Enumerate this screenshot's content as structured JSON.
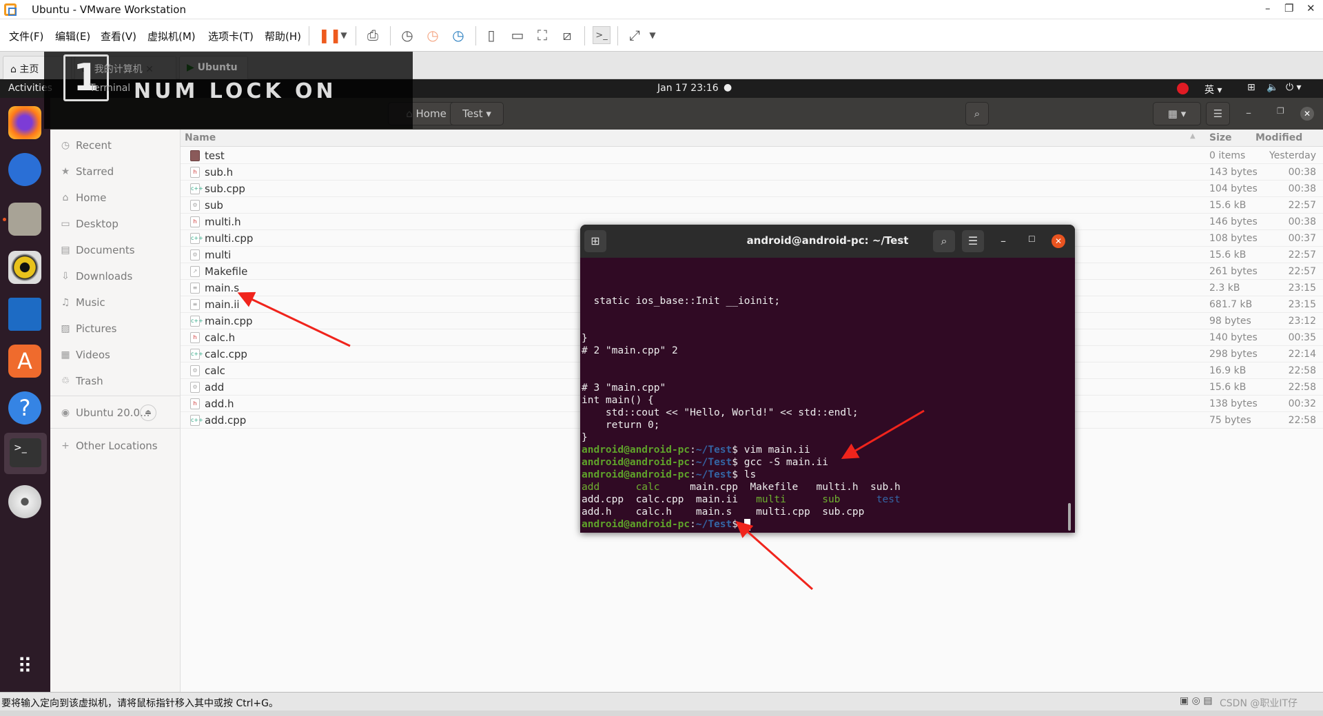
{
  "window": {
    "title": "Ubuntu - VMware Workstation",
    "min": "–",
    "max": "❐",
    "close": "✕"
  },
  "menu": [
    "文件(F)",
    "编辑(E)",
    "查看(V)",
    "虚拟机(M)",
    "选项卡(T)",
    "帮助(H)"
  ],
  "toolbar_icons": [
    "pause-icon",
    "send-keys-icon",
    "snapshot-icon",
    "revert-snapshot-icon",
    "snapshot-manager-icon",
    "sidebar-view-icon",
    "thumbnail-view-icon",
    "fullscreen-icon",
    "unity-icon",
    "console-view-icon",
    "stretch-icon"
  ],
  "tabs": [
    {
      "label": "主页"
    },
    {
      "label": "我的计算机"
    },
    {
      "label": "Ubuntu"
    }
  ],
  "gnome": {
    "activities": "Activities",
    "app": "Terminal",
    "clock": "Jan 17  23:16",
    "ime": "英"
  },
  "numlock": {
    "digit": "1",
    "text": "NUM LOCK ON"
  },
  "nautilus": {
    "path": [
      "Home",
      "Test"
    ],
    "columns": {
      "name": "Name",
      "size": "Size",
      "modified": "Modified"
    }
  },
  "sidebar": [
    {
      "label": "Recent",
      "icon": "◷"
    },
    {
      "label": "Starred",
      "icon": "★"
    },
    {
      "label": "Home",
      "icon": "⌂"
    },
    {
      "label": "Desktop",
      "icon": "▭"
    },
    {
      "label": "Documents",
      "icon": "▤"
    },
    {
      "label": "Downloads",
      "icon": "⇩"
    },
    {
      "label": "Music",
      "icon": "♫"
    },
    {
      "label": "Pictures",
      "icon": "▨"
    },
    {
      "label": "Videos",
      "icon": "▦"
    },
    {
      "label": "Trash",
      "icon": "♲"
    }
  ],
  "volume": {
    "label": "Ubuntu 20.0...",
    "eject": "⏏"
  },
  "other_locations": "Other Locations",
  "files": [
    {
      "name": "test",
      "type": "folder",
      "size": "0 items",
      "modified": "Yesterday"
    },
    {
      "name": "sub.h",
      "type": "h",
      "size": "143 bytes",
      "modified": "00:38"
    },
    {
      "name": "sub.cpp",
      "type": "cpp",
      "size": "104 bytes",
      "modified": "00:38"
    },
    {
      "name": "sub",
      "type": "exec",
      "size": "15.6 kB",
      "modified": "22:57"
    },
    {
      "name": "multi.h",
      "type": "h",
      "size": "146 bytes",
      "modified": "00:38"
    },
    {
      "name": "multi.cpp",
      "type": "cpp",
      "size": "108 bytes",
      "modified": "00:37"
    },
    {
      "name": "multi",
      "type": "exec",
      "size": "15.6 kB",
      "modified": "22:57"
    },
    {
      "name": "Makefile",
      "type": "make",
      "size": "261 bytes",
      "modified": "22:57"
    },
    {
      "name": "main.s",
      "type": "text",
      "size": "2.3 kB",
      "modified": "23:15"
    },
    {
      "name": "main.ii",
      "type": "text",
      "size": "681.7 kB",
      "modified": "23:15"
    },
    {
      "name": "main.cpp",
      "type": "cpp",
      "size": "98 bytes",
      "modified": "23:12"
    },
    {
      "name": "calc.h",
      "type": "h",
      "size": "140 bytes",
      "modified": "00:35"
    },
    {
      "name": "calc.cpp",
      "type": "cpp",
      "size": "298 bytes",
      "modified": "22:14"
    },
    {
      "name": "calc",
      "type": "exec",
      "size": "16.9 kB",
      "modified": "22:58"
    },
    {
      "name": "add",
      "type": "exec",
      "size": "15.6 kB",
      "modified": "22:58"
    },
    {
      "name": "add.h",
      "type": "h",
      "size": "138 bytes",
      "modified": "00:32"
    },
    {
      "name": "add.cpp",
      "type": "cpp",
      "size": "75 bytes",
      "modified": "22:58"
    }
  ],
  "terminal": {
    "title": "android@android-pc: ~/Test",
    "lines": [
      [],
      [],
      [],
      [
        {
          "t": "  static ios_base::Init __ioinit;"
        }
      ],
      [],
      [],
      [
        {
          "t": "}"
        }
      ],
      [
        {
          "t": "# 2 \"main.cpp\" 2"
        }
      ],
      [],
      [],
      [
        {
          "t": "# 3 \"main.cpp\""
        }
      ],
      [
        {
          "t": "int main() {"
        }
      ],
      [
        {
          "t": "    std::cout << \"Hello, World!\" << std::endl;"
        }
      ],
      [
        {
          "t": "    return 0;"
        }
      ],
      [
        {
          "t": "}"
        }
      ],
      [
        {
          "t": "android@android-pc",
          "c": "green"
        },
        {
          "t": ":"
        },
        {
          "t": "~/Test",
          "c": "blue"
        },
        {
          "t": "$ vim main.ii"
        }
      ],
      [
        {
          "t": "android@android-pc",
          "c": "green"
        },
        {
          "t": ":"
        },
        {
          "t": "~/Test",
          "c": "blue"
        },
        {
          "t": "$ gcc -S main.ii"
        }
      ],
      [
        {
          "t": "android@android-pc",
          "c": "green"
        },
        {
          "t": ":"
        },
        {
          "t": "~/Test",
          "c": "blue"
        },
        {
          "t": "$ ls"
        }
      ],
      [
        {
          "t": "add      ",
          "c": "lgreen"
        },
        {
          "t": "calc     ",
          "c": "lgreen"
        },
        {
          "t": "main.cpp  Makefile   multi.h  sub.h"
        }
      ],
      [
        {
          "t": "add.cpp  calc.cpp  main.ii   "
        },
        {
          "t": "multi",
          "c": "lgreen"
        },
        {
          "t": "      "
        },
        {
          "t": "sub",
          "c": "lgreen"
        },
        {
          "t": "      "
        },
        {
          "t": "test",
          "c": "dblue"
        }
      ],
      [
        {
          "t": "add.h    calc.h    main.s    multi.cpp  sub.cpp"
        }
      ],
      [
        {
          "t": "android@android-pc",
          "c": "green"
        },
        {
          "t": ":"
        },
        {
          "t": "~/Test",
          "c": "blue"
        },
        {
          "t": "$ "
        }
      ]
    ]
  },
  "statusbar": {
    "message": "要将输入定向到该虚拟机，请将鼠标指针移入其中或按 Ctrl+G。",
    "watermark": "CSDN @职业IT仔"
  },
  "colors": {
    "accent": "#e95420",
    "terminal_bg": "#300a24",
    "prompt_user": "#5fa32a",
    "prompt_path": "#3465a4",
    "arrow": "#f0241c"
  }
}
